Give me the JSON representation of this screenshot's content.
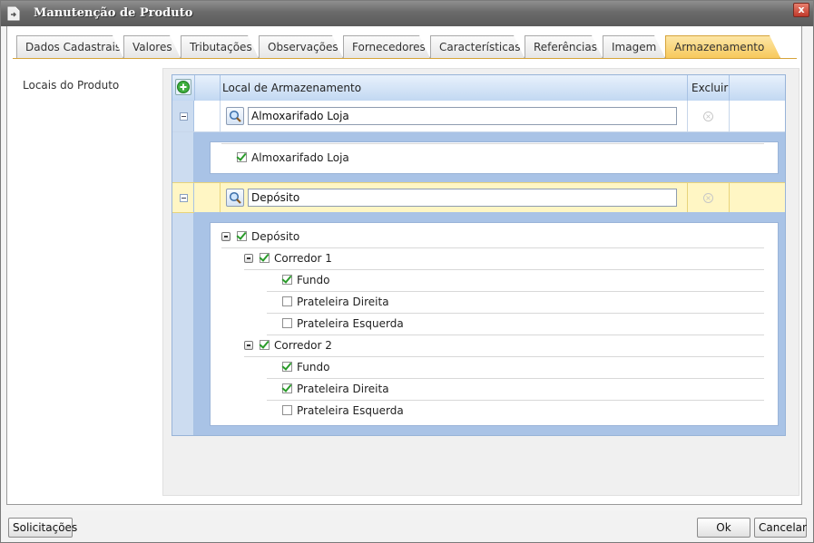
{
  "window": {
    "title": "Manutenção de Produto",
    "close_glyph": "x"
  },
  "tabs": [
    {
      "label": "Dados Cadastrais"
    },
    {
      "label": "Valores"
    },
    {
      "label": "Tributações"
    },
    {
      "label": "Observações"
    },
    {
      "label": "Fornecedores"
    },
    {
      "label": "Características"
    },
    {
      "label": "Referências"
    },
    {
      "label": "Imagem"
    },
    {
      "label": "Armazenamento",
      "active": true
    }
  ],
  "section": {
    "label": "Locais do Produto"
  },
  "grid": {
    "col_local": "Local de Armazenamento",
    "col_excluir": "Excluir",
    "rows": [
      {
        "value": "Almoxarifado Loja",
        "tree": [
          {
            "label": "Almoxarifado Loja",
            "checked": true
          }
        ]
      },
      {
        "value": "Depósito",
        "selected": true,
        "tree": [
          {
            "label": "Depósito",
            "checked": true
          },
          {
            "label": "Corredor 1",
            "checked": true
          },
          {
            "label": "Fundo",
            "checked": true
          },
          {
            "label": "Prateleira Direita",
            "checked": false
          },
          {
            "label": "Prateleira Esquerda",
            "checked": false
          },
          {
            "label": "Corredor 2",
            "checked": true
          },
          {
            "label": "Fundo",
            "checked": true
          },
          {
            "label": "Prateleira Direita",
            "checked": true
          },
          {
            "label": "Prateleira Esquerda",
            "checked": false
          }
        ]
      }
    ]
  },
  "footer": {
    "solicitacoes": "Solicitações",
    "ok": "Ok",
    "cancelar": "Cancelar"
  },
  "colors": {
    "active_tab": "#f7c95c",
    "grid_header": "#c2d8f2",
    "selected_row": "#fff6c4"
  }
}
